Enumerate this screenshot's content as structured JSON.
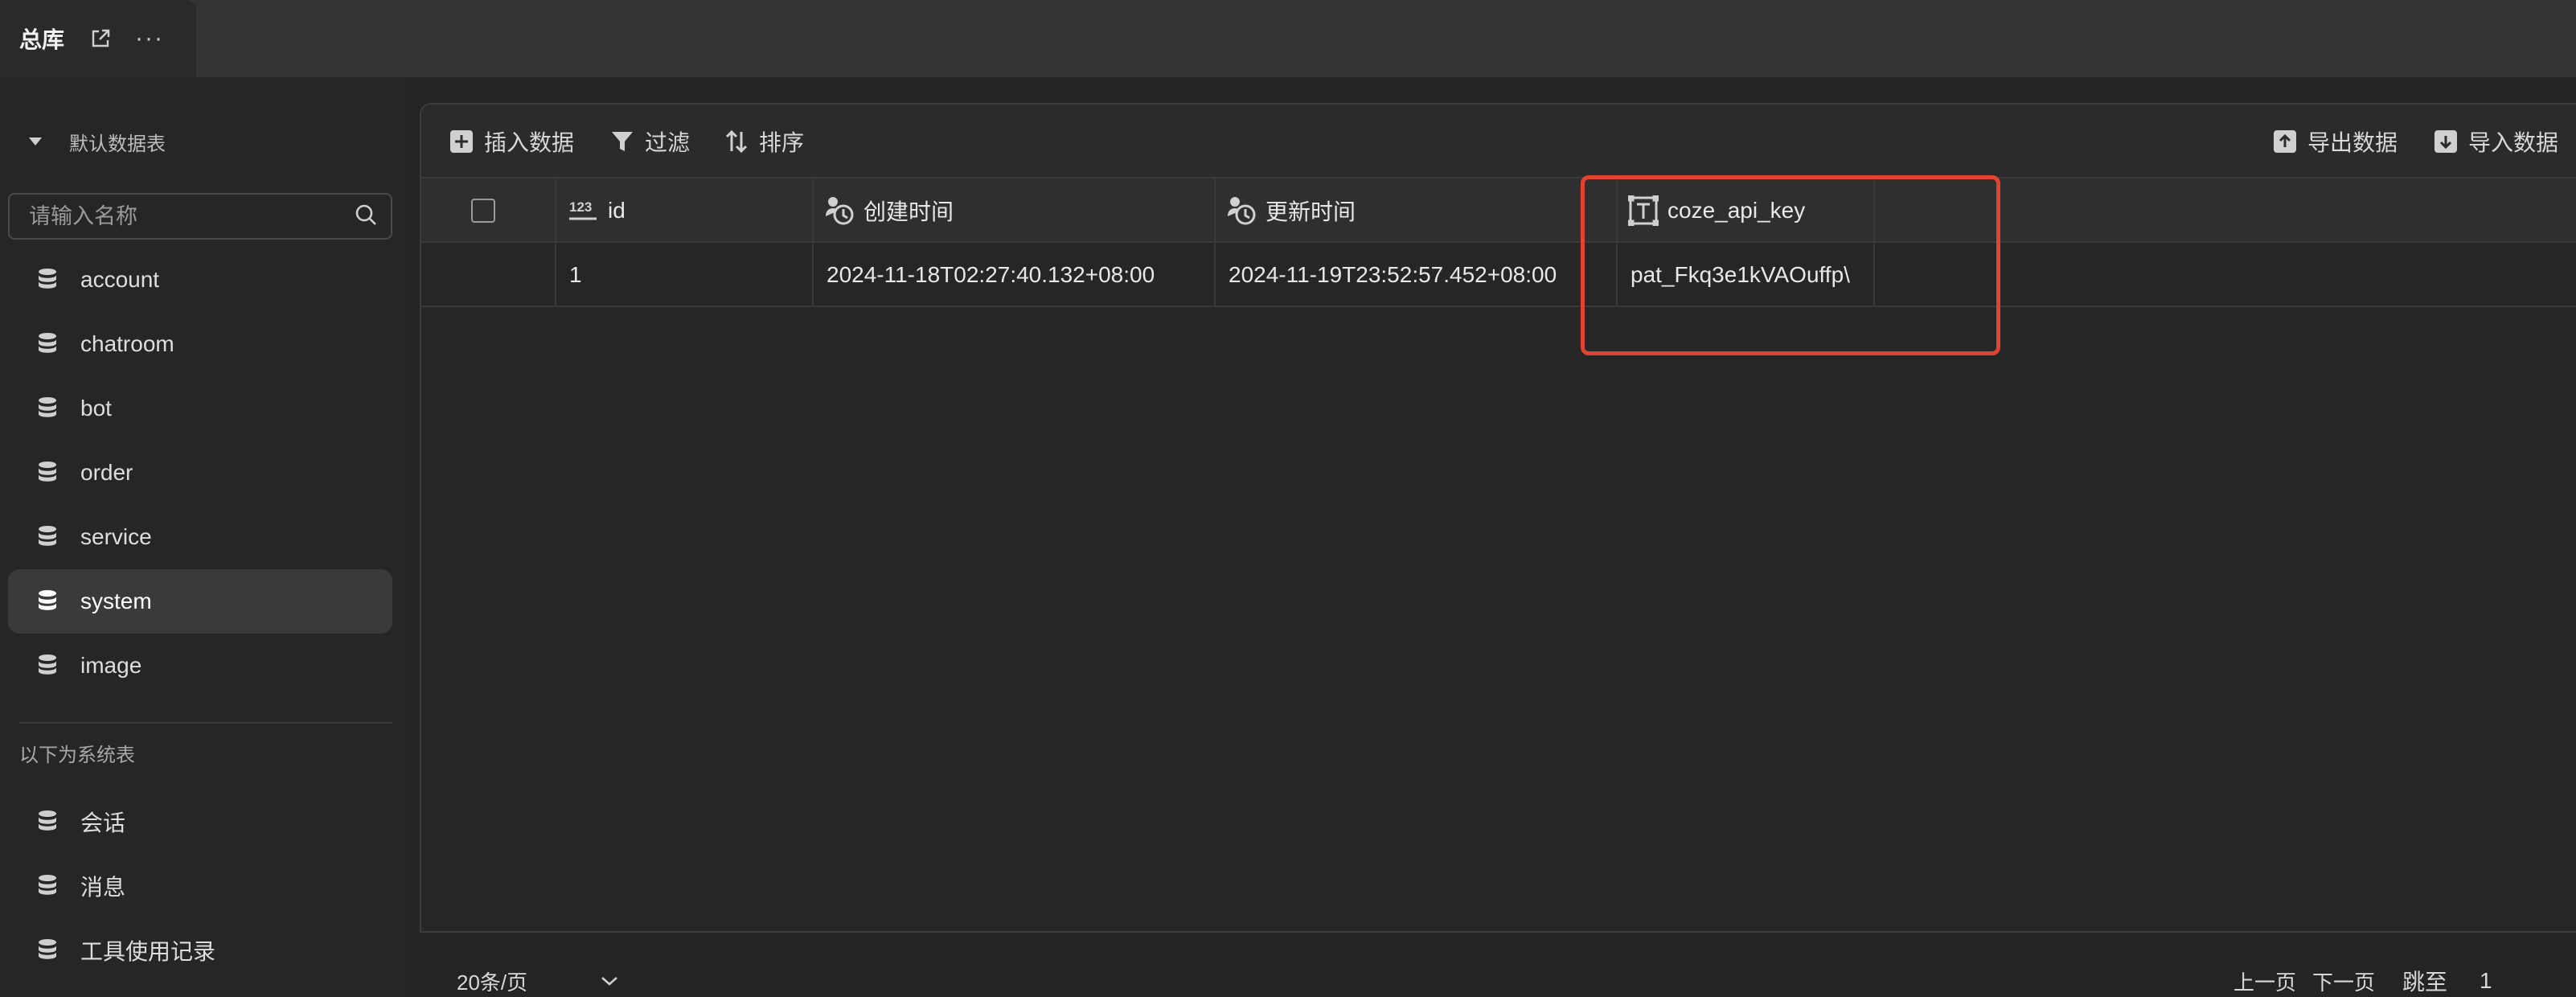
{
  "tab": {
    "title": "总库",
    "open_icon": "external-link-icon",
    "more_label": "···"
  },
  "sidebar": {
    "section_label": "默认数据表",
    "search_placeholder": "请输入名称",
    "tables": [
      {
        "label": "account",
        "icon": "database-icon"
      },
      {
        "label": "chatroom",
        "icon": "database-icon"
      },
      {
        "label": "bot",
        "icon": "database-icon"
      },
      {
        "label": "order",
        "icon": "database-icon"
      },
      {
        "label": "service",
        "icon": "database-icon"
      },
      {
        "label": "system",
        "icon": "database-icon",
        "selected": true
      },
      {
        "label": "image",
        "icon": "database-icon"
      }
    ],
    "system_label": "以下为系统表",
    "system_tables": [
      {
        "label": "会话",
        "icon": "database-icon"
      },
      {
        "label": "消息",
        "icon": "database-icon"
      },
      {
        "label": "工具使用记录",
        "icon": "database-icon"
      }
    ]
  },
  "toolbar": {
    "insert_label": "插入数据",
    "filter_label": "过滤",
    "sort_label": "排序",
    "export_label": "导出数据",
    "import_label": "导入数据"
  },
  "table": {
    "columns": [
      {
        "label": "id",
        "type_icon": "number-type-icon",
        "type_text": "123"
      },
      {
        "label": "创建时间",
        "type_icon": "clock-user-icon"
      },
      {
        "label": "更新时间",
        "type_icon": "clock-user-icon"
      },
      {
        "label": "coze_api_key",
        "type_icon": "text-type-icon"
      }
    ],
    "rows": [
      [
        "1",
        "2024-11-18T02:27:40.132+08:00",
        "2024-11-19T23:52:57.452+08:00",
        "pat_Fkq3e1kVAOuffp\\"
      ]
    ]
  },
  "footer": {
    "page_size": "20条/页",
    "prev_label": "上一页",
    "next_label": "下一页",
    "jump_label": "跳至",
    "jump_value": "1"
  },
  "colors": {
    "highlight": "#e0432f",
    "background": "#242424"
  }
}
